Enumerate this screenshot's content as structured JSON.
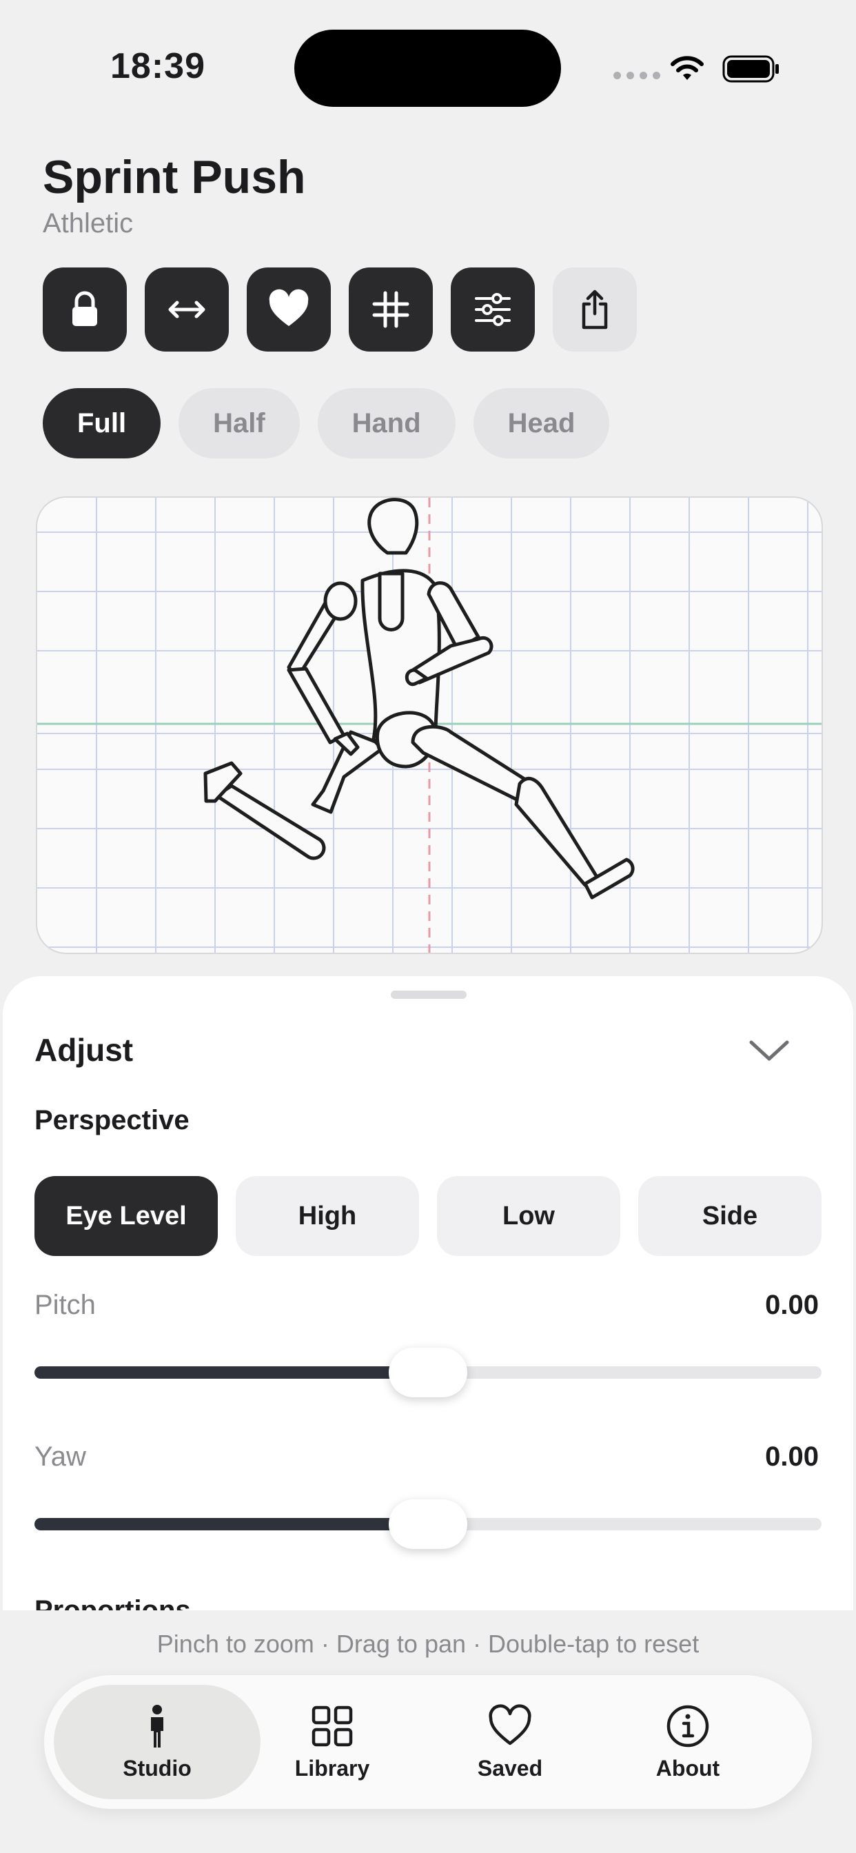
{
  "status_bar": {
    "time": "18:39"
  },
  "header": {
    "title": "Sprint Push",
    "subtitle": "Athletic"
  },
  "toolbar": {
    "buttons": [
      {
        "icon": "lock-icon"
      },
      {
        "icon": "flip-horizontal-icon"
      },
      {
        "icon": "heart-icon"
      },
      {
        "icon": "grid-icon"
      },
      {
        "icon": "sliders-icon"
      },
      {
        "icon": "share-icon"
      }
    ]
  },
  "crop_chips": {
    "items": [
      "Full",
      "Half",
      "Hand",
      "Head"
    ],
    "selected": "Full"
  },
  "adjust": {
    "title": "Adjust",
    "perspective_label": "Perspective",
    "perspective_options": [
      "Eye Level",
      "High",
      "Low",
      "Side"
    ],
    "perspective_selected": "Eye Level",
    "pitch": {
      "label": "Pitch",
      "value_text": "0.00",
      "level_fraction": 0.5
    },
    "yaw": {
      "label": "Yaw",
      "value_text": "0.00",
      "level_fraction": 0.5
    },
    "next_section_label": "Proportions"
  },
  "hint": "Pinch to zoom · Drag to pan · Double-tap to reset",
  "tabbar": {
    "items": [
      {
        "label": "Studio",
        "icon": "person-icon"
      },
      {
        "label": "Library",
        "icon": "grid-squares-icon"
      },
      {
        "label": "Saved",
        "icon": "heart-icon"
      },
      {
        "label": "About",
        "icon": "info-icon"
      }
    ],
    "selected": "Studio"
  },
  "colors": {
    "accent_dark": "#2a2a2c",
    "background": "#f0f0f0",
    "grid_line": "#c8d2f0",
    "horizon_line": "#9ccfb8",
    "center_line": "#e89aa4"
  }
}
